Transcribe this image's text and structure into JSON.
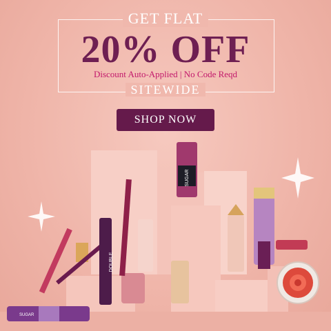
{
  "promo": {
    "top_line": "GET FLAT",
    "headline": "20% OFF",
    "subline": "Discount Auto-Applied | No Code Reqd",
    "bottom_line": "SITEWIDE",
    "cta_label": "SHOP NOW"
  },
  "product_labels": {
    "mascara": "DOUBLE",
    "nail_polish": "SUGAR",
    "liner": "SUGAR"
  },
  "colors": {
    "background": "#f0b8ad",
    "headline": "#6e1f52",
    "subline": "#c2186b",
    "cta_bg": "#651a4b",
    "pedestal": "#f7cfc6"
  }
}
